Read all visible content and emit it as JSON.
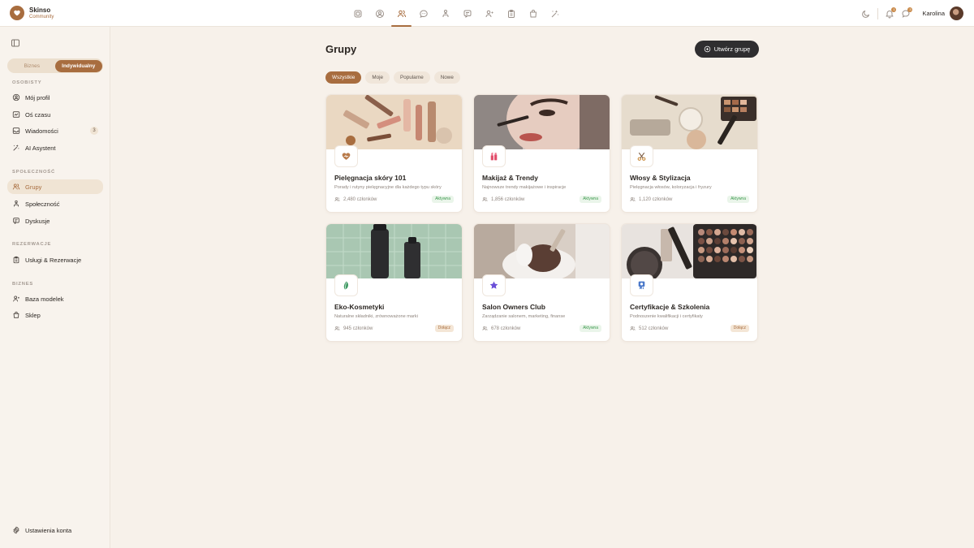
{
  "brand": {
    "name": "Skinso",
    "subtitle": "Community"
  },
  "topnav": [
    {
      "icon": "dashboard-icon"
    },
    {
      "icon": "user-circle-icon"
    },
    {
      "icon": "groups-icon",
      "active": true
    },
    {
      "icon": "chat-icon"
    },
    {
      "icon": "community-icon"
    },
    {
      "icon": "discussion-icon"
    },
    {
      "icon": "contacts-icon"
    },
    {
      "icon": "clipboard-icon"
    },
    {
      "icon": "shopping-bag-icon"
    },
    {
      "icon": "ai-tools-icon"
    }
  ],
  "header": {
    "user_name": "Karolina",
    "notifications_badge": "1",
    "messages_badge": "3"
  },
  "sidebar": {
    "mode_toggle": {
      "business": "Biznes",
      "individual": "Indywidualny",
      "selected": "Indywidualny"
    },
    "sections": [
      {
        "title": "OSOBISTY",
        "items": [
          {
            "label": "Mój profil",
            "icon": "user-circle-icon"
          },
          {
            "label": "Oś czasu",
            "icon": "timeline-icon"
          },
          {
            "label": "Wiadomości",
            "icon": "inbox-icon",
            "count": "3"
          },
          {
            "label": "AI Asystent",
            "icon": "ai-tools-icon"
          }
        ]
      },
      {
        "title": "SPOŁECZNOŚĆ",
        "items": [
          {
            "label": "Grupy",
            "icon": "groups-icon",
            "active": true
          },
          {
            "label": "Społeczność",
            "icon": "community-icon"
          },
          {
            "label": "Dyskusje",
            "icon": "discussion-icon"
          }
        ]
      },
      {
        "title": "REZERWACJE",
        "items": [
          {
            "label": "Usługi & Rezerwacje",
            "icon": "clipboard-icon"
          }
        ]
      },
      {
        "title": "BIZNES",
        "items": [
          {
            "label": "Baza modelek",
            "icon": "contacts-icon"
          },
          {
            "label": "Sklep",
            "icon": "shopping-bag-icon"
          }
        ]
      }
    ],
    "footer_item": {
      "label": "Ustawienia konta",
      "icon": "gear-icon"
    }
  },
  "main": {
    "title": "Grupy",
    "create_button": "Utwórz grupę",
    "filters": [
      {
        "label": "Wszystkie",
        "active": true
      },
      {
        "label": "Moje"
      },
      {
        "label": "Popularne"
      },
      {
        "label": "Nowe"
      }
    ],
    "groups": [
      {
        "title": "Pielęgnacja skóry 101",
        "description": "Porady i rutyny pielęgnacyjne dla każdego typu skóry",
        "members": "2,480 członków",
        "status": "Aktywna",
        "status_type": "active",
        "icon": "heart-icon"
      },
      {
        "title": "Makijaż & Trendy",
        "description": "Najnowsze trendy makijażowe i inspiracje",
        "members": "1,856 członków",
        "status": "Aktywna",
        "status_type": "active",
        "icon": "lipstick-icon"
      },
      {
        "title": "Włosy & Stylizacja",
        "description": "Pielęgnacja włosów, koloryzacja i fryzury",
        "members": "1,120 członków",
        "status": "Aktywna",
        "status_type": "active",
        "icon": "scissors-icon"
      },
      {
        "title": "Eko-Kosmetyki",
        "description": "Naturalne składniki, zrównoważone marki",
        "members": "945 członków",
        "status": "Dołącz",
        "status_type": "join",
        "icon": "leaf-icon"
      },
      {
        "title": "Salon Owners Club",
        "description": "Zarządzanie salonem, marketing, finanse",
        "members": "678 członków",
        "status": "Aktywna",
        "status_type": "active",
        "icon": "star-icon"
      },
      {
        "title": "Certyfikacje & Szkolenia",
        "description": "Podnoszenie kwalifikacji i certyfikaty",
        "members": "512 członków",
        "status": "Dołącz",
        "status_type": "join",
        "icon": "certificate-icon"
      }
    ]
  },
  "colors": {
    "accent": "#a86d3f",
    "background": "#f7f1ea",
    "dark_button": "#2f2e30",
    "active_status": "#3d9a4f"
  }
}
